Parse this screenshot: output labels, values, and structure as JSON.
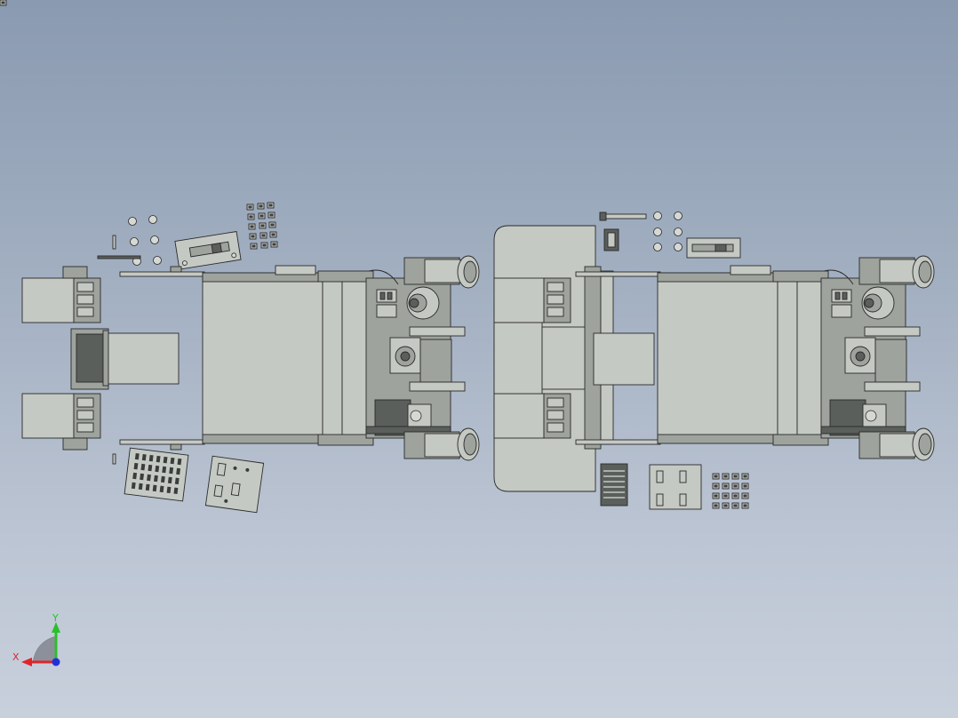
{
  "triad": {
    "x_label": "X",
    "y_label": "Y",
    "x_color": "#e0242a",
    "y_color": "#2bbf2b",
    "z_color": "#2230d8"
  },
  "colors": {
    "part_light": "#c5c9c3",
    "part_mid": "#9ea39d",
    "part_dark": "#5a5f5c",
    "edge": "#2a2a2a"
  }
}
